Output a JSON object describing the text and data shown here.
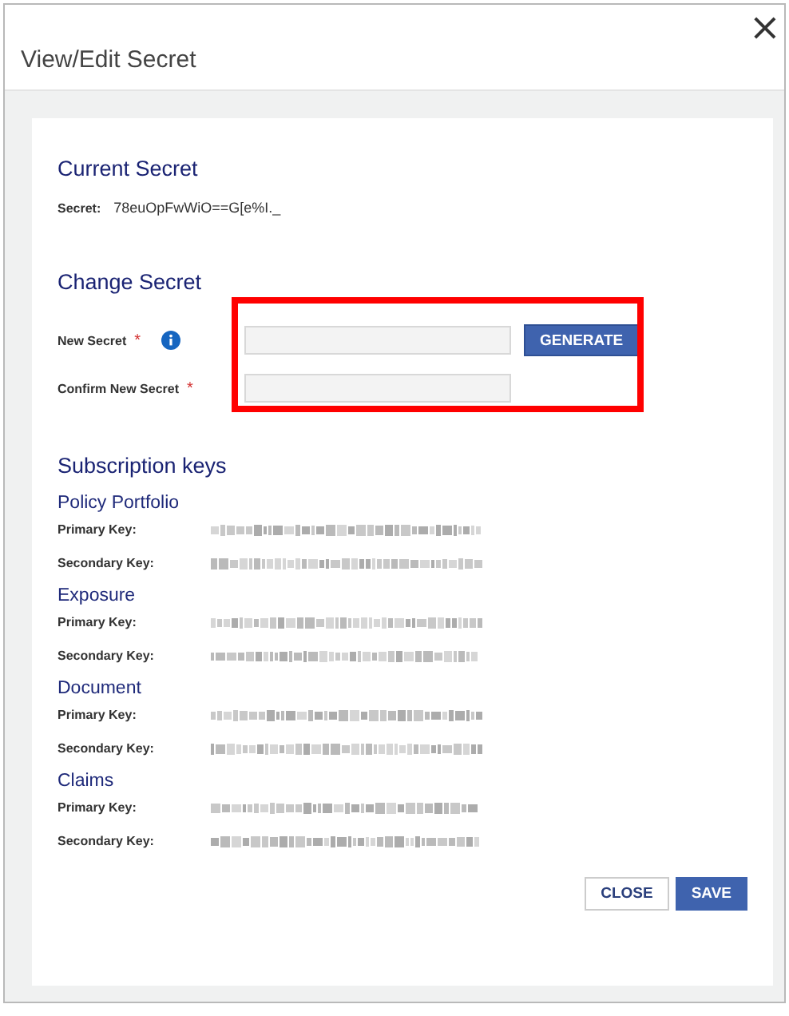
{
  "dialog": {
    "title": "View/Edit Secret",
    "close_icon": "×"
  },
  "current_secret": {
    "heading": "Current Secret",
    "label": "Secret:",
    "value": "78euOpFwWiO==G[e%I._"
  },
  "change_secret": {
    "heading": "Change Secret",
    "highlighted": true,
    "fields": [
      {
        "label": "New Secret",
        "required_mark": "*",
        "info": true,
        "button": "GENERATE"
      },
      {
        "label": "Confirm New Secret",
        "required_mark": "*",
        "info": false
      }
    ]
  },
  "subscription_keys": {
    "heading": "Subscription keys",
    "groups": [
      {
        "name": "Policy Portfolio",
        "keys": [
          {
            "label": "Primary Key:",
            "kind": "blurred"
          },
          {
            "label": "Secondary Key:",
            "kind": "blurred"
          }
        ]
      },
      {
        "name": "Exposure",
        "keys": [
          {
            "label": "Primary Key:",
            "kind": "blurred"
          },
          {
            "label": "Secondary Key:",
            "kind": "blurred"
          }
        ]
      },
      {
        "name": "Document",
        "keys": [
          {
            "label": "Primary Key:",
            "kind": "blurred"
          },
          {
            "label": "Secondary Key:",
            "kind": "blurred"
          }
        ]
      },
      {
        "name": "Claims",
        "keys": [
          {
            "label": "Primary Key:",
            "kind": "blurred"
          },
          {
            "label": "Secondary Key:",
            "kind": "blurred"
          }
        ]
      }
    ]
  },
  "buttons": [
    {
      "label": "CLOSE",
      "kind": "secondary"
    },
    {
      "label": "SAVE",
      "kind": "primary"
    }
  ]
}
